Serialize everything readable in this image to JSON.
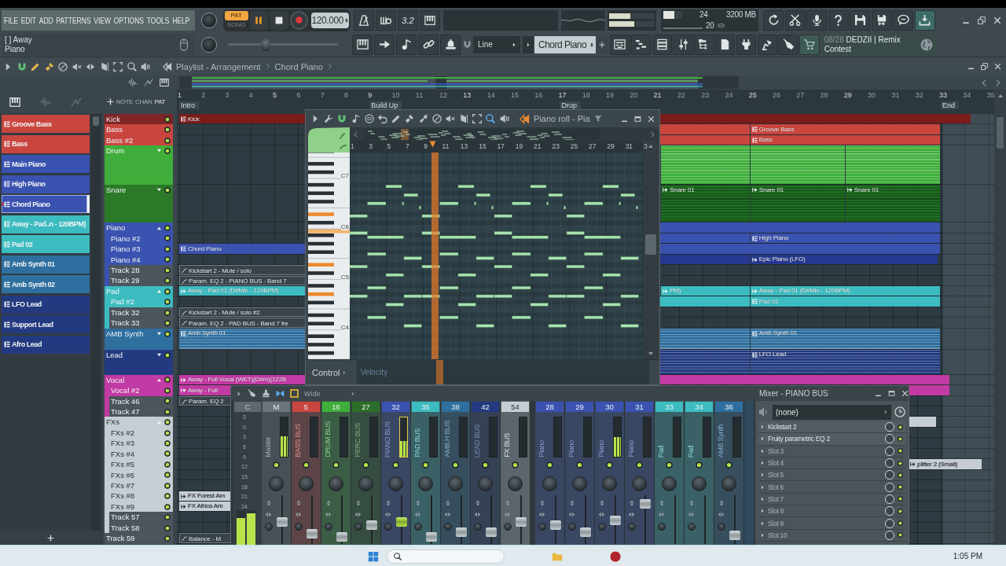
{
  "menu": [
    "FILE",
    "EDIT",
    "ADD",
    "PATTERNS",
    "VIEW",
    "OPTIONS",
    "TOOLS",
    "HELP"
  ],
  "hint_bar": {
    "title": "[ ] Away",
    "subtitle": "Piano"
  },
  "transport": {
    "modes": [
      {
        "label": "PAT",
        "selected": true
      },
      {
        "label": "SONG",
        "selected": false
      }
    ],
    "playing": true,
    "recording": false,
    "tempo": "120.000",
    "countdown": "3.2"
  },
  "output_meter": [
    {
      "level": 0.46
    },
    {
      "level": 0.55
    }
  ],
  "master_pitch": {
    "level": 0.34
  },
  "performance": {
    "cpu": "24",
    "memory": "3200 MB",
    "polyphony": "20"
  },
  "snap": "Line",
  "pattern_selector": "Chord Piano",
  "news": {
    "date": "08/28",
    "text": "DEDZII | Remix Contest"
  },
  "playlist": {
    "title": "Playlist - Arrangement",
    "breadcrumb": "Chord Piano",
    "view_modes": [
      "NOTE",
      "CHAN",
      "PAT"
    ],
    "patterns": [
      {
        "label": "Groove Bass",
        "color": "#c9463f",
        "selected": false
      },
      {
        "label": "Bass",
        "color": "#c9463f",
        "selected": false
      },
      {
        "label": "Main Piano",
        "color": "#3a52b0",
        "selected": false
      },
      {
        "label": "High Piano",
        "color": "#3a52b0",
        "selected": false
      },
      {
        "label": "Chord Piano",
        "color": "#3a52b0",
        "selected": true
      },
      {
        "label": "Away - Pad..n - 120BPM)",
        "color": "#3cbcc0",
        "selected": false
      },
      {
        "label": "Pad 02",
        "color": "#3cbcc0",
        "selected": false
      },
      {
        "label": "Amb Synth 01",
        "color": "#2e6f9f",
        "selected": false
      },
      {
        "label": "Amb Synth 02",
        "color": "#2e6f9f",
        "selected": false
      },
      {
        "label": "LFO Lead",
        "color": "#243a80",
        "selected": false
      },
      {
        "label": "Support Lead",
        "color": "#243a80",
        "selected": false
      },
      {
        "label": "Afro Lead",
        "color": "#243a80",
        "selected": false
      }
    ],
    "ruler": [
      "1",
      "2",
      "3",
      "4",
      "5",
      "6",
      "7",
      "8",
      "9",
      "10",
      "11",
      "12",
      "13",
      "14",
      "15",
      "16",
      "17",
      "18",
      "19",
      "20",
      "21",
      "22",
      "23",
      "24",
      "25",
      "26",
      "27",
      "28",
      "29",
      "30",
      "31",
      "32",
      "33",
      "34",
      "35"
    ],
    "markers": [
      "Intro",
      "Build Up",
      "Drop",
      "End"
    ],
    "tracks": [
      {
        "label": "Kick",
        "color": "#7f2525",
        "enabled": true,
        "clips": [
          {
            "label": "Kick",
            "kind": "pattern",
            "color": "#7a1c1c"
          }
        ]
      },
      {
        "label": "Bass",
        "color": "#c9463f",
        "enabled": true,
        "clips": [
          {
            "kind": "pattern",
            "color": "#c9463f"
          },
          {
            "label": "Groove Bass",
            "kind": "pattern",
            "color": "#c9463f"
          }
        ]
      },
      {
        "label": "Bass #2",
        "color": "#c9463f",
        "enabled": true,
        "clips": [
          {
            "kind": "pattern",
            "color": "#c9463f"
          },
          {
            "label": "Bass",
            "kind": "pattern",
            "color": "#c9463f"
          }
        ]
      },
      {
        "label": "Drum",
        "color": "#3fae3a",
        "expanded": false,
        "enabled": true,
        "clips": [
          {
            "kind": "pattern",
            "color": "#3fae3a"
          },
          {
            "kind": "pattern",
            "color": "#3fae3a"
          },
          {
            "kind": "pattern",
            "color": "#3fae3a"
          }
        ]
      },
      {
        "label": "Snare",
        "color": "#2b7a27",
        "expanded": false,
        "enabled": true,
        "clips": [
          {
            "label": "Snare 01",
            "kind": "audio",
            "color": "#1f6e22"
          },
          {
            "label": "Snare 01",
            "kind": "audio",
            "color": "#1f6e22"
          },
          {
            "label": "Snare 01",
            "kind": "audio",
            "color": "#1f6e22"
          }
        ]
      },
      {
        "label": "Piano",
        "color": "#3a52b0",
        "expanded": true,
        "enabled": true,
        "clips": [
          {
            "kind": "pattern",
            "color": "#3a52b0"
          }
        ],
        "children": [
          {
            "label": "Piano #2",
            "color": "#3a52b0",
            "enabled": true,
            "clips": [
              {
                "kind": "pattern",
                "color": "#3a52b0"
              },
              {
                "label": "High Piano",
                "kind": "pattern",
                "color": "#3a52b0"
              }
            ]
          },
          {
            "label": "Piano #3",
            "color": "#3a52b0",
            "enabled": true,
            "clips": [
              {
                "label": "Chord Piano",
                "kind": "pattern",
                "color": "#3a52b0"
              },
              {
                "kind": "pattern",
                "color": "#3a52b0"
              }
            ]
          },
          {
            "label": "Piano #4",
            "color": "#3a52b0",
            "enabled": true,
            "clips": [
              {
                "kind": "audio",
                "color": "#26388f"
              },
              {
                "label": "Epic Piano (LFO)",
                "kind": "audio",
                "color": "#26388f"
              }
            ]
          },
          {
            "label": "Track 28",
            "color": "#4c555b",
            "enabled": true,
            "clips": [
              {
                "label": "Kickstart 2 - Mute / solo",
                "kind": "automation",
                "color": "#3a4349"
              }
            ]
          },
          {
            "label": "Track 29",
            "color": "#4c555b",
            "enabled": true,
            "clips": [
              {
                "label": "Param. EQ 2 - PIANO BUS - Band 7",
                "kind": "automation",
                "color": "#3a4349"
              }
            ]
          }
        ]
      },
      {
        "label": "Pad",
        "color": "#3cbcc0",
        "expanded": true,
        "enabled": true,
        "clips": [
          {
            "label": "Away - Pad 01 (D#Min - 120BPM)",
            "kind": "audio",
            "color": "#3cbcc0"
          },
          {
            "label": "PM)",
            "kind": "audio",
            "color": "#3cbcc0"
          },
          {
            "label": "Away - Pad 01 (D#Min - 120BPM)",
            "kind": "audio",
            "color": "#3cbcc0"
          }
        ],
        "children": [
          {
            "label": "Pad #2",
            "color": "#3cbcc0",
            "enabled": true,
            "clips": [
              {
                "kind": "pattern",
                "color": "#3cbcc0"
              },
              {
                "label": "Pad 02",
                "kind": "pattern",
                "color": "#3cbcc0"
              }
            ]
          },
          {
            "label": "Track 32",
            "color": "#4c555b",
            "enabled": true,
            "clips": [
              {
                "label": "Kickstart 2 - Mute / solo #2",
                "kind": "automation",
                "color": "#3a4349"
              }
            ]
          },
          {
            "label": "Track 33",
            "color": "#4c555b",
            "enabled": true,
            "clips": [
              {
                "label": "Param. EQ 2 - PAD BUS - Band 7 fre",
                "kind": "automation",
                "color": "#3a4349"
              }
            ]
          }
        ]
      },
      {
        "label": "AMB Synth",
        "color": "#2e6f9f",
        "expanded": false,
        "enabled": true,
        "clips": [
          {
            "label": "Amb Synth 01",
            "kind": "pattern",
            "color": "#2e6f9f"
          },
          {
            "kind": "pattern",
            "color": "#2e6f9f"
          },
          {
            "label": "Amb Synth 01",
            "kind": "pattern",
            "color": "#2e6f9f"
          }
        ]
      },
      {
        "label": "Lead",
        "color": "#243a80",
        "expanded": false,
        "enabled": true,
        "clips": [
          {
            "kind": "pattern",
            "color": "#243a80"
          },
          {
            "label": "LFO Lead",
            "kind": "pattern",
            "color": "#243a80"
          }
        ]
      },
      {
        "label": "Vocal",
        "color": "#c23aa3",
        "expanded": true,
        "enabled": true,
        "clips": [
          {
            "label": "Away - Full Vocal (WET)(D#m)(122B",
            "kind": "audio",
            "color": "#c23aa3"
          },
          {
            "kind": "audio",
            "color": "#c23aa3"
          }
        ],
        "children": [
          {
            "label": "Vocal #2",
            "color": "#c23aa3",
            "enabled": true,
            "clips": [
              {
                "label": "Away - Full",
                "kind": "audio",
                "color": "#c23aa3"
              },
              {
                "kind": "audio",
                "color": "#c23aa3"
              }
            ]
          },
          {
            "label": "Track 46",
            "color": "#4c555b",
            "enabled": true,
            "clips": [
              {
                "label": "Param. EQ 2",
                "kind": "automation",
                "color": "#3a4349"
              }
            ]
          },
          {
            "label": "Track 47",
            "color": "#4c555b",
            "enabled": true
          }
        ]
      },
      {
        "label": "FXs",
        "color": "#c7ced3",
        "expanded": true,
        "enabled": true,
        "clips": [
          {
            "kind": "audio",
            "color": "#c7ced3"
          }
        ],
        "children": [
          {
            "label": "FXs #2",
            "color": "#c7ced3",
            "enabled": true
          },
          {
            "label": "FXs #3",
            "color": "#c7ced3",
            "enabled": true
          },
          {
            "label": "FXs #4",
            "color": "#c7ced3",
            "enabled": true
          },
          {
            "label": "FXs #5",
            "color": "#c7ced3",
            "enabled": true,
            "clips": [
              {
                "label": "plitter 2 (Small)",
                "kind": "audio",
                "color": "#c7ced3"
              }
            ]
          },
          {
            "label": "FXs #6",
            "color": "#c7ced3",
            "enabled": true
          },
          {
            "label": "FXs #7",
            "color": "#c7ced3",
            "enabled": true
          },
          {
            "label": "FXs #8",
            "color": "#c7ced3",
            "enabled": true,
            "clips": [
              {
                "label": "FX Forest Am",
                "kind": "audio",
                "color": "#c7ced3"
              }
            ]
          },
          {
            "label": "FXs #9",
            "color": "#c7ced3",
            "enabled": true,
            "clips": [
              {
                "label": "FX Africa Am",
                "kind": "audio",
                "color": "#c7ced3"
              }
            ]
          },
          {
            "label": "Track 57",
            "color": "#4c555b",
            "enabled": true
          },
          {
            "label": "Track 58",
            "color": "#4c555b",
            "enabled": true
          }
        ]
      },
      {
        "label": "Track 59",
        "color": "#4c555b",
        "enabled": true,
        "clips": [
          {
            "label": "Balance - M",
            "kind": "automation",
            "color": "#3a4349"
          }
        ]
      }
    ]
  },
  "piano_roll": {
    "title": "Piano roll - Pia",
    "ruler": [
      "1",
      "3",
      "5",
      "7",
      "9",
      "11",
      "13",
      "15",
      "17",
      "19",
      "21",
      "23",
      "25",
      "27",
      "29",
      "31",
      "3"
    ],
    "keys": [
      "C7",
      "C6",
      "C5",
      "C4"
    ],
    "control": "Control",
    "parameter": "Velocity"
  },
  "mixer": {
    "preset": "Wide",
    "title": "Mixer - PIANO BUS",
    "master_meter": {
      "number": "C",
      "scale": [
        "3",
        "0",
        "3",
        "6",
        "9",
        "12",
        "15",
        "18",
        "21",
        "24"
      ],
      "channels": [
        {
          "level": 0.78
        },
        {
          "level": 0.9
        }
      ]
    },
    "strips": [
      {
        "number": "M",
        "name": "Master",
        "color": "#6b7479",
        "selected": false,
        "enabled": true,
        "meter": {
          "level": 0.52
        },
        "fader": {
          "level": 0.45
        }
      },
      {
        "number": "5",
        "name": "BASS BUS",
        "color": "#c9463f",
        "selected": false,
        "enabled": true,
        "fader": {
          "level": 0.21
        }
      },
      {
        "number": "16",
        "name": "DRUM BUS",
        "color": "#3fae3a",
        "selected": false,
        "enabled": true,
        "fader": {
          "level": 0.15
        }
      },
      {
        "number": "27",
        "name": "PERC BUS",
        "color": "#2b6e27",
        "selected": false,
        "enabled": true,
        "fader": {
          "level": 0.39
        }
      },
      {
        "number": "32",
        "name": "PIANO BUS",
        "color": "#3a52b0",
        "selected": true,
        "enabled": true,
        "meter": {
          "level": 0.4
        },
        "fader": {
          "level": 0.45
        }
      },
      {
        "number": "35",
        "name": "PAD BUS",
        "color": "#3cbcc0",
        "selected": false,
        "enabled": true,
        "fader": {
          "level": 0.15
        }
      },
      {
        "number": "38",
        "name": "AMB.H BUS",
        "color": "#2e6f9f",
        "selected": false,
        "enabled": true,
        "fader": {
          "level": 0.24
        }
      },
      {
        "number": "42",
        "name": "LEAD BUS",
        "color": "#243a80",
        "selected": false,
        "enabled": true,
        "fader": {
          "level": 0.24
        }
      },
      {
        "number": "54",
        "name": "FX BUS",
        "color": "#c7ced3",
        "selected": false,
        "enabled": true,
        "fader": {
          "level": 0.45
        }
      },
      {
        "number": "28",
        "name": "Piano",
        "color": "#3a52b0",
        "selected": false,
        "enabled": true,
        "fader": {
          "level": 0.39
        }
      },
      {
        "number": "29",
        "name": "Piano",
        "color": "#3a52b0",
        "selected": false,
        "enabled": true,
        "fader": {
          "level": 0.24
        }
      },
      {
        "number": "30",
        "name": "Piano",
        "color": "#3a52b0",
        "selected": false,
        "enabled": true,
        "meter": {
          "level": 0.5
        },
        "fader": {
          "level": 0.48
        }
      },
      {
        "number": "31",
        "name": "Piano",
        "color": "#3a52b0",
        "selected": false,
        "enabled": true,
        "fader": {
          "level": 0.82
        }
      },
      {
        "number": "33",
        "name": "Pad",
        "color": "#3cbcc0",
        "selected": false,
        "enabled": true
      },
      {
        "number": "34",
        "name": "Pad",
        "color": "#3cbcc0",
        "selected": false,
        "enabled": true
      },
      {
        "number": "36",
        "name": "AMB Synth",
        "color": "#2e6f9f",
        "selected": false,
        "enabled": true,
        "fader": {
          "level": 0.18
        }
      }
    ],
    "input": "(none)",
    "slots": [
      {
        "label": "Kickstart 2",
        "kind": "plugin"
      },
      {
        "label": "Fruity parametric EQ 2",
        "kind": "plugin"
      },
      {
        "label": "Slot 3",
        "kind": "empty"
      },
      {
        "label": "Slot 4",
        "kind": "empty"
      },
      {
        "label": "Slot 5",
        "kind": "empty"
      },
      {
        "label": "Slot 6",
        "kind": "empty"
      },
      {
        "label": "Slot 7",
        "kind": "empty"
      },
      {
        "label": "Slot 8",
        "kind": "empty"
      },
      {
        "label": "Slot 9",
        "kind": "empty"
      },
      {
        "label": "Slot 10",
        "kind": "empty"
      }
    ]
  },
  "taskbar": {
    "time": "1:05 PM"
  }
}
